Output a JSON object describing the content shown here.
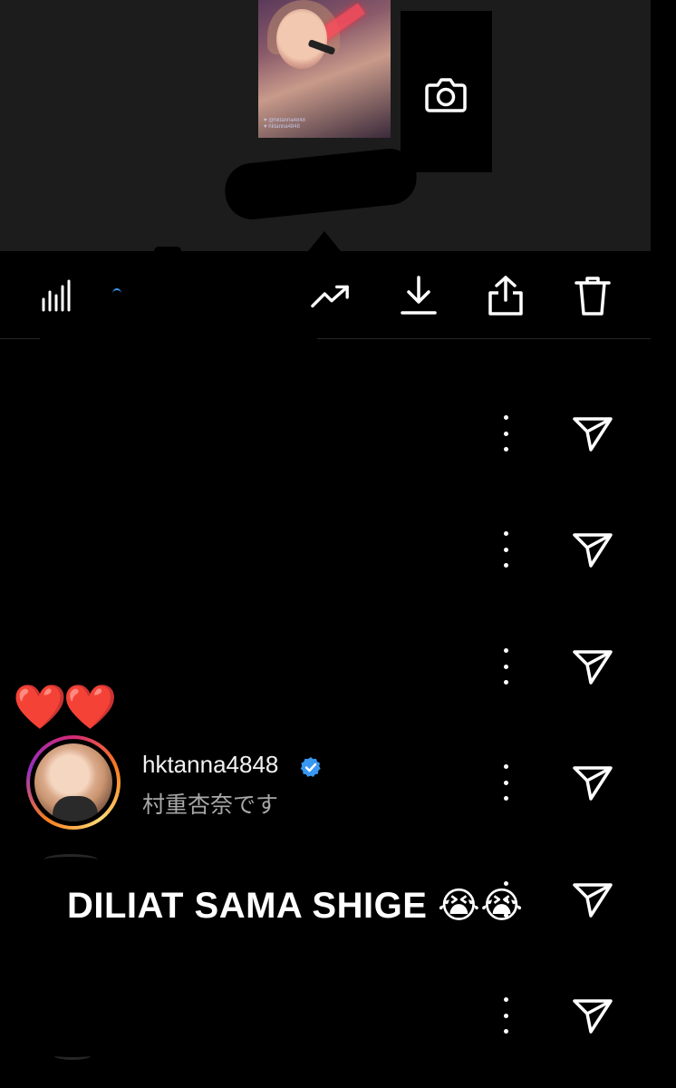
{
  "story_preview": {
    "caption": "♥ @hktanna4848\n♥ hktanna4848"
  },
  "toolbar": {
    "items": [
      "insights-icon",
      "trending-icon",
      "download-icon",
      "share-icon",
      "delete-icon"
    ]
  },
  "viewer": {
    "reaction": "❤️❤️",
    "username": "hktanna4848",
    "verified": true,
    "display_name": "村重杏奈です"
  },
  "overlay": {
    "text": "DILIAT SAMA SHIGE 😭😭"
  },
  "colors": {
    "background": "#000000",
    "story_bg": "#1c1c1c",
    "verified_blue": "#3897f0",
    "subtitle": "#a8a8a8"
  }
}
